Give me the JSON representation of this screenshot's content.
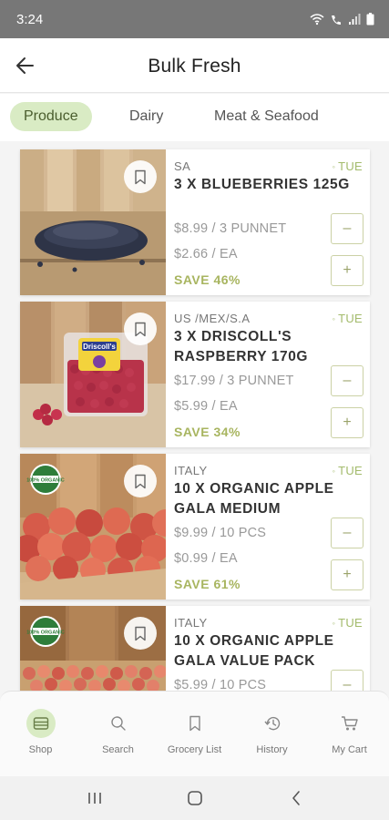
{
  "status_bar": {
    "time": "3:24"
  },
  "header": {
    "title": "Bulk Fresh"
  },
  "tabs": [
    {
      "label": "Produce",
      "active": true
    },
    {
      "label": "Dairy",
      "active": false
    },
    {
      "label": "Meat & Seafood",
      "active": false
    }
  ],
  "products": [
    {
      "origin": "SA",
      "day": "TUE",
      "name": "3 X BLUEBERRIES 125G",
      "pack_price": "$8.99 / 3 PUNNET",
      "unit_price": "$2.66 / EA",
      "savings": "SAVE 46%"
    },
    {
      "origin": "US /MEX/S.A",
      "day": "TUE",
      "name": "3 X DRISCOLL'S RASPBERRY 170G",
      "pack_price": "$17.99 / 3 PUNNET",
      "unit_price": "$5.99 / EA",
      "savings": "SAVE 34%",
      "image_text": "Driscoll's"
    },
    {
      "origin": "ITALY",
      "day": "TUE",
      "name": "10 X ORGANIC APPLE GALA MEDIUM",
      "pack_price": "$9.99 / 10 PCS",
      "unit_price": "$0.99 / EA",
      "savings": "SAVE 61%",
      "image_badge": "100% ORGANIC"
    },
    {
      "origin": "ITALY",
      "day": "TUE",
      "name": "10 X ORGANIC APPLE GALA VALUE PACK",
      "pack_price": "$5.99 / 10 PCS",
      "image_badge": "100% ORGANIC"
    }
  ],
  "bottom_nav": [
    {
      "label": "Shop",
      "icon": "shop-icon",
      "active": true
    },
    {
      "label": "Search",
      "icon": "search-icon",
      "active": false
    },
    {
      "label": "Grocery List",
      "icon": "bookmark-icon",
      "active": false
    },
    {
      "label": "History",
      "icon": "history-icon",
      "active": false
    },
    {
      "label": "My Cart",
      "icon": "cart-icon",
      "active": false
    }
  ],
  "colors": {
    "accent_green": "#d9ebc4",
    "savings_text": "#a8b560",
    "status_bar": "#777777"
  }
}
